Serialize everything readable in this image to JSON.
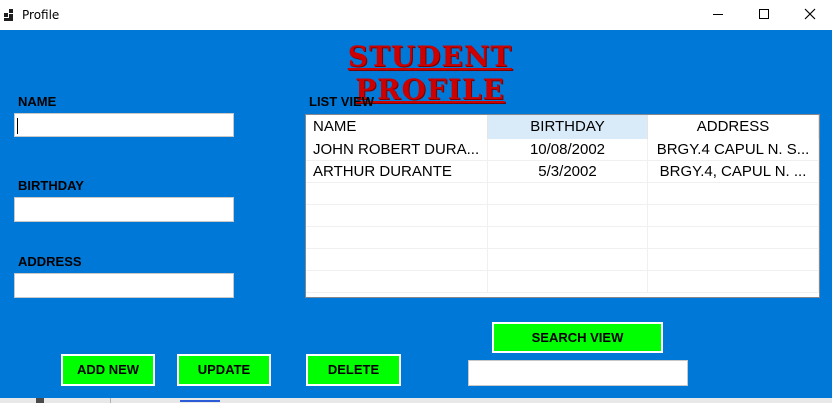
{
  "window": {
    "title": "Profile"
  },
  "heading": "STUDENT PROFILE",
  "form": {
    "name_label": "NAME",
    "name_value": "",
    "birthday_label": "BIRTHDAY",
    "birthday_value": "",
    "address_label": "ADDRESS",
    "address_value": ""
  },
  "listview": {
    "label": "LIST VIEW",
    "columns": [
      "NAME",
      "BIRTHDAY",
      "ADDRESS"
    ],
    "rows": [
      [
        "JOHN ROBERT DURA...",
        "10/08/2002",
        "BRGY.4 CAPUL N. S..."
      ],
      [
        "ARTHUR DURANTE",
        "5/3/2002",
        "BRGY.4, CAPUL N. ..."
      ]
    ]
  },
  "buttons": {
    "add_new": "ADD NEW",
    "update": "UPDATE",
    "delete": "DELETE",
    "search_view": "SEARCH VIEW"
  },
  "search": {
    "value": ""
  },
  "colors": {
    "form_background": "#0078d7",
    "heading": "#cc0000",
    "button": "#00ff00",
    "header_highlight": "#d9ebf9"
  }
}
